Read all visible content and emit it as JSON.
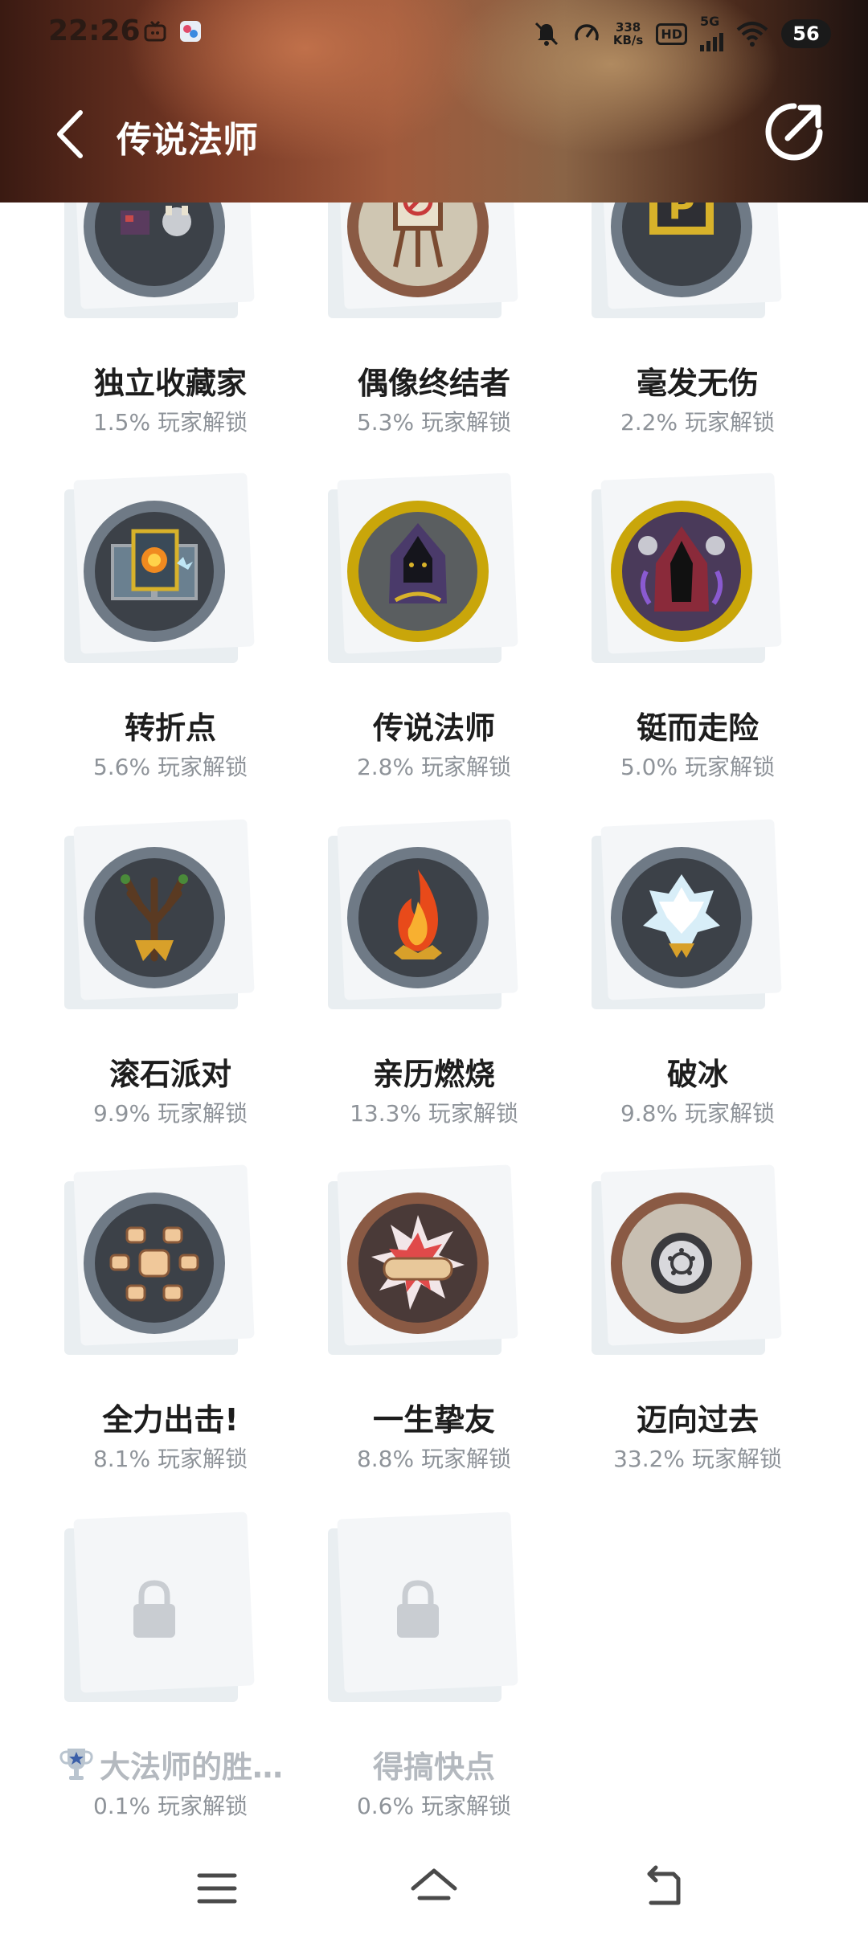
{
  "status_bar": {
    "time": "22:26",
    "net_speed_value": "338",
    "net_speed_unit": "KB/s",
    "hd_label": "HD",
    "network_label": "5G",
    "battery_level": "56"
  },
  "header": {
    "title": "传说法师"
  },
  "achievements": [
    {
      "name": "独立收藏家",
      "pct": "1.5% 玩家解锁",
      "icon": "collector-badge-icon",
      "ring": "#6f7a86"
    },
    {
      "name": "偶像终结者",
      "pct": "5.3% 玩家解锁",
      "icon": "idol-ender-badge-icon",
      "ring": "#8a5a44"
    },
    {
      "name": "毫发无伤",
      "pct": "2.2% 玩家解锁",
      "icon": "unscathed-badge-icon",
      "ring": "#6f7a86"
    },
    {
      "name": "转折点",
      "pct": "5.6% 玩家解锁",
      "icon": "turning-point-badge-icon",
      "ring": "#6f7a86"
    },
    {
      "name": "传说法师",
      "pct": "2.8% 玩家解锁",
      "icon": "legendary-wizard-badge-icon",
      "ring": "#c9a60a"
    },
    {
      "name": "铤而走险",
      "pct": "5.0% 玩家解锁",
      "icon": "risk-taker-badge-icon",
      "ring": "#c9a60a"
    },
    {
      "name": "滚石派对",
      "pct": "9.9% 玩家解锁",
      "icon": "rolling-stone-badge-icon",
      "ring": "#6f7a86"
    },
    {
      "name": "亲历燃烧",
      "pct": "13.3% 玩家解锁",
      "icon": "burning-badge-icon",
      "ring": "#6f7a86"
    },
    {
      "name": "破冰",
      "pct": "9.8% 玩家解锁",
      "icon": "ice-breaker-badge-icon",
      "ring": "#6f7a86"
    },
    {
      "name": "全力出击!",
      "pct": "8.1% 玩家解锁",
      "icon": "full-strike-badge-icon",
      "ring": "#6f7a86"
    },
    {
      "name": "一生挚友",
      "pct": "8.8% 玩家解锁",
      "icon": "lifelong-friend-badge-icon",
      "ring": "#8a5a44"
    },
    {
      "name": "迈向过去",
      "pct": "33.2% 玩家解锁",
      "icon": "toward-past-badge-icon",
      "ring": "#8a5a44"
    },
    {
      "name": "大法师的胜…",
      "pct": "0.1% 玩家解锁",
      "icon": "lock-icon",
      "locked": true,
      "trophy": true
    },
    {
      "name": "得搞快点",
      "pct": "0.6% 玩家解锁",
      "icon": "lock-icon",
      "locked": true
    }
  ]
}
